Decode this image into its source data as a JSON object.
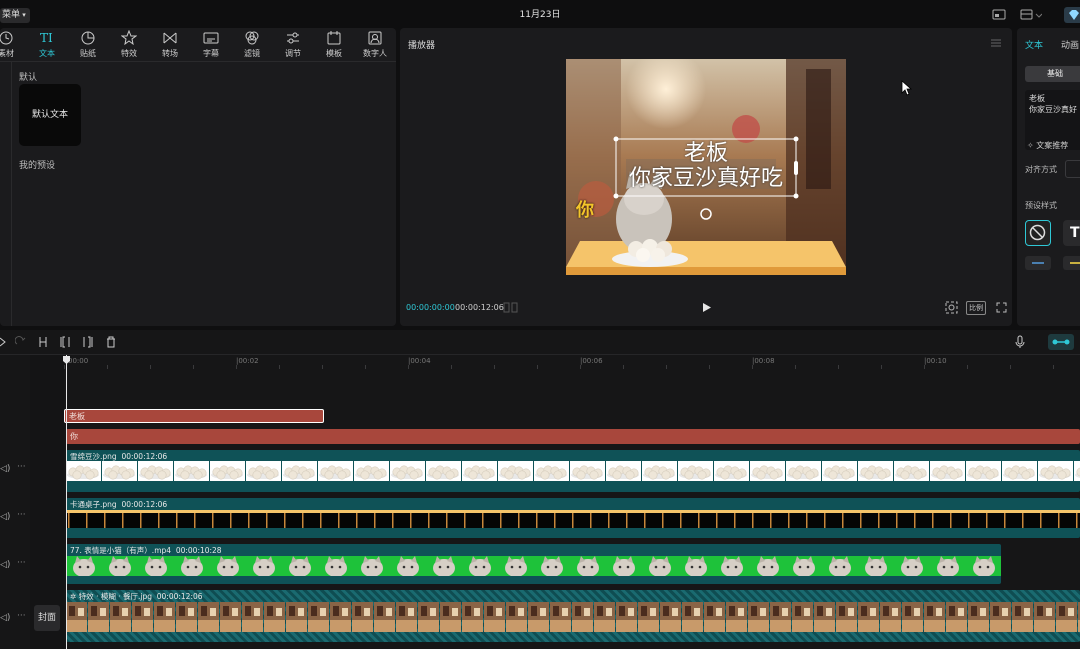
{
  "titlebar": {
    "menu": "菜单",
    "date": "11月23日"
  },
  "toolbar": {
    "items": [
      {
        "label": "素材",
        "icon": "media-icon"
      },
      {
        "label": "文本",
        "icon": "text-icon"
      },
      {
        "label": "贴纸",
        "icon": "sticker-icon"
      },
      {
        "label": "特效",
        "icon": "effects-icon"
      },
      {
        "label": "转场",
        "icon": "transition-icon"
      },
      {
        "label": "字幕",
        "icon": "subtitle-icon"
      },
      {
        "label": "滤镜",
        "icon": "filter-icon"
      },
      {
        "label": "调节",
        "icon": "adjust-icon"
      },
      {
        "label": "模板",
        "icon": "template-icon"
      },
      {
        "label": "数字人",
        "icon": "avatar-icon"
      }
    ]
  },
  "library": {
    "section_default": "默认",
    "default_text": "默认文本",
    "section_presets": "我的预设"
  },
  "player": {
    "title": "播放器",
    "caption_line1": "老板",
    "caption_line2": "你家豆沙真好吃",
    "side_text": "你",
    "time_current": "00:00:00:00",
    "time_total": "00:00:12:06",
    "ratio_label": "比例"
  },
  "inspector": {
    "tab_text": "文本",
    "tab_animation": "动画",
    "subtab_basic": "基础",
    "text_value_line1": "老板",
    "text_value_line2": "你家豆沙真好",
    "recommend": "文案推荐",
    "align_label": "对齐方式",
    "preset_label": "预设样式"
  },
  "timeline": {
    "ruler": [
      "00:00",
      "|00:02",
      "|00:04",
      "|00:06",
      "|00:08",
      "|00:10"
    ],
    "cover_label": "封面",
    "clips": [
      {
        "name": "老板",
        "type": "text"
      },
      {
        "name": "你",
        "type": "text"
      },
      {
        "name": "雪绵豆沙.png",
        "duration": "00:00:12:06",
        "type": "image"
      },
      {
        "name": "卡通桌子.png",
        "duration": "00:00:12:06",
        "type": "image"
      },
      {
        "name": "77. 表情是小猫（有声）.mp4",
        "duration": "00:00:10:28",
        "type": "video"
      },
      {
        "name": "特效 · 模糊 · 餐厅.jpg",
        "duration": "00:00:12:06",
        "type": "image"
      }
    ]
  },
  "colors": {
    "accent": "#2fc8d6",
    "text_clip": "#a8473c",
    "teal_clip": "#0f5257",
    "green": "#22c33a"
  }
}
